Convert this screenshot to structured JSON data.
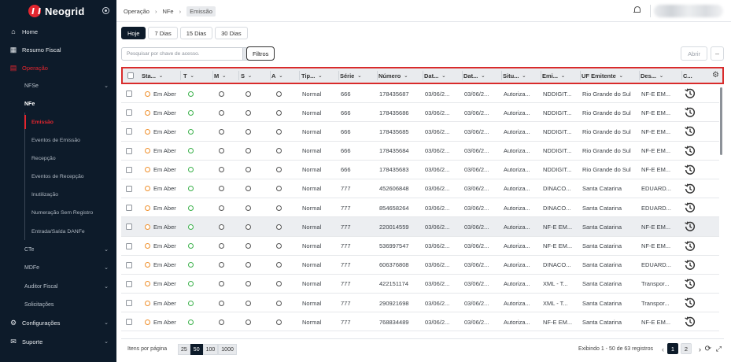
{
  "sidebar": {
    "logo": "Neogrid",
    "items": [
      {
        "label": "Home",
        "icon": "home-icon"
      },
      {
        "label": "Resumo Fiscal",
        "icon": "building-icon"
      },
      {
        "label": "Operação",
        "icon": "document-icon"
      },
      {
        "label": "NFSe"
      },
      {
        "label": "NFe"
      },
      {
        "label": "Emissão"
      },
      {
        "label": "Eventos de Emissão"
      },
      {
        "label": "Recepção"
      },
      {
        "label": "Eventos de Recepção"
      },
      {
        "label": "Inutilização"
      },
      {
        "label": "Numeração Sem Registro"
      },
      {
        "label": "Entrada/Saída DANFe"
      },
      {
        "label": "CTe"
      },
      {
        "label": "MDFe"
      },
      {
        "label": "Auditor Fiscal"
      },
      {
        "label": "Solicitações"
      },
      {
        "label": "Configurações",
        "icon": "gear-icon"
      },
      {
        "label": "Suporte",
        "icon": "mail-icon"
      }
    ]
  },
  "breadcrumb": [
    "Operação",
    "NFe",
    "Emissão"
  ],
  "tabs": [
    "Hoje",
    "7 Dias",
    "15 Dias",
    "30 Dias"
  ],
  "search": {
    "placeholder": "Pesquisar por chave de acesso."
  },
  "buttons": {
    "filters": "Filtros",
    "open": "Abrir",
    "minus": "–"
  },
  "columns": [
    "Sta...",
    "T",
    "M",
    "S",
    "A",
    "Tip...",
    "Série",
    "Número",
    "Dat...",
    "Dat...",
    "Situ...",
    "Emi...",
    "UF Emitente",
    "Des...",
    "C..."
  ],
  "rows": [
    {
      "status": "Em Aber",
      "tipo": "Normal",
      "serie": "666",
      "numero": "178435687",
      "data1": "03/06/2...",
      "data2": "03/06/2...",
      "situacao": "Autoriza...",
      "emitente": "NDDIGIT...",
      "uf": "Rio Grande do Sul",
      "destinatario": "NF-E EM..."
    },
    {
      "status": "Em Aber",
      "tipo": "Normal",
      "serie": "666",
      "numero": "178435686",
      "data1": "03/06/2...",
      "data2": "03/06/2...",
      "situacao": "Autoriza...",
      "emitente": "NDDIGIT...",
      "uf": "Rio Grande do Sul",
      "destinatario": "NF-E EM..."
    },
    {
      "status": "Em Aber",
      "tipo": "Normal",
      "serie": "666",
      "numero": "178435685",
      "data1": "03/06/2...",
      "data2": "03/06/2...",
      "situacao": "Autoriza...",
      "emitente": "NDDIGIT...",
      "uf": "Rio Grande do Sul",
      "destinatario": "NF-E EM..."
    },
    {
      "status": "Em Aber",
      "tipo": "Normal",
      "serie": "666",
      "numero": "178435684",
      "data1": "03/06/2...",
      "data2": "03/06/2...",
      "situacao": "Autoriza...",
      "emitente": "NDDIGIT...",
      "uf": "Rio Grande do Sul",
      "destinatario": "NF-E EM..."
    },
    {
      "status": "Em Aber",
      "tipo": "Normal",
      "serie": "666",
      "numero": "178435683",
      "data1": "03/06/2...",
      "data2": "03/06/2...",
      "situacao": "Autoriza...",
      "emitente": "NDDIGIT...",
      "uf": "Rio Grande do Sul",
      "destinatario": "NF-E EM..."
    },
    {
      "status": "Em Aber",
      "tipo": "Normal",
      "serie": "777",
      "numero": "452606848",
      "data1": "03/06/2...",
      "data2": "03/06/2...",
      "situacao": "Autoriza...",
      "emitente": "DINACO...",
      "uf": "Santa Catarina",
      "destinatario": "EDUARD..."
    },
    {
      "status": "Em Aber",
      "tipo": "Normal",
      "serie": "777",
      "numero": "854658264",
      "data1": "03/06/2...",
      "data2": "03/06/2...",
      "situacao": "Autoriza...",
      "emitente": "DINACO...",
      "uf": "Santa Catarina",
      "destinatario": "EDUARD..."
    },
    {
      "status": "Em Aber",
      "tipo": "Normal",
      "serie": "777",
      "numero": "220014559",
      "data1": "03/06/2...",
      "data2": "03/06/2...",
      "situacao": "Autoriza...",
      "emitente": "NF-E EM...",
      "uf": "Santa Catarina",
      "destinatario": "NF-E EM..."
    },
    {
      "status": "Em Aber",
      "tipo": "Normal",
      "serie": "777",
      "numero": "536997547",
      "data1": "03/06/2...",
      "data2": "03/06/2...",
      "situacao": "Autoriza...",
      "emitente": "NF-E EM...",
      "uf": "Santa Catarina",
      "destinatario": "NF-E EM..."
    },
    {
      "status": "Em Aber",
      "tipo": "Normal",
      "serie": "777",
      "numero": "606376808",
      "data1": "03/06/2...",
      "data2": "03/06/2...",
      "situacao": "Autoriza...",
      "emitente": "DINACO...",
      "uf": "Santa Catarina",
      "destinatario": "EDUARD..."
    },
    {
      "status": "Em Aber",
      "tipo": "Normal",
      "serie": "777",
      "numero": "422151174",
      "data1": "03/06/2...",
      "data2": "03/06/2...",
      "situacao": "Autoriza...",
      "emitente": "XML - T...",
      "uf": "Santa Catarina",
      "destinatario": "Transpor..."
    },
    {
      "status": "Em Aber",
      "tipo": "Normal",
      "serie": "777",
      "numero": "290921698",
      "data1": "03/06/2...",
      "data2": "03/06/2...",
      "situacao": "Autoriza...",
      "emitente": "XML - T...",
      "uf": "Santa Catarina",
      "destinatario": "Transpor..."
    },
    {
      "status": "Em Aber",
      "tipo": "Normal",
      "serie": "777",
      "numero": "768834489",
      "data1": "03/06/2...",
      "data2": "03/06/2...",
      "situacao": "Autoriza...",
      "emitente": "NF-E EM...",
      "uf": "Santa Catarina",
      "destinatario": "NF-E EM..."
    }
  ],
  "footer": {
    "items_per_page": "Itens por página",
    "sizes": [
      "25",
      "50",
      "100",
      "1000"
    ],
    "selected_size": "50",
    "showing": "Exibindo 1 - 50 de 63 registros",
    "pages": [
      "1",
      "2"
    ],
    "current_page": "1"
  },
  "colors": {
    "accent": "#e3262f",
    "sidebar": "#0d1b2a",
    "status_open": "#f0902c",
    "ok_green": "#3bb14a"
  }
}
